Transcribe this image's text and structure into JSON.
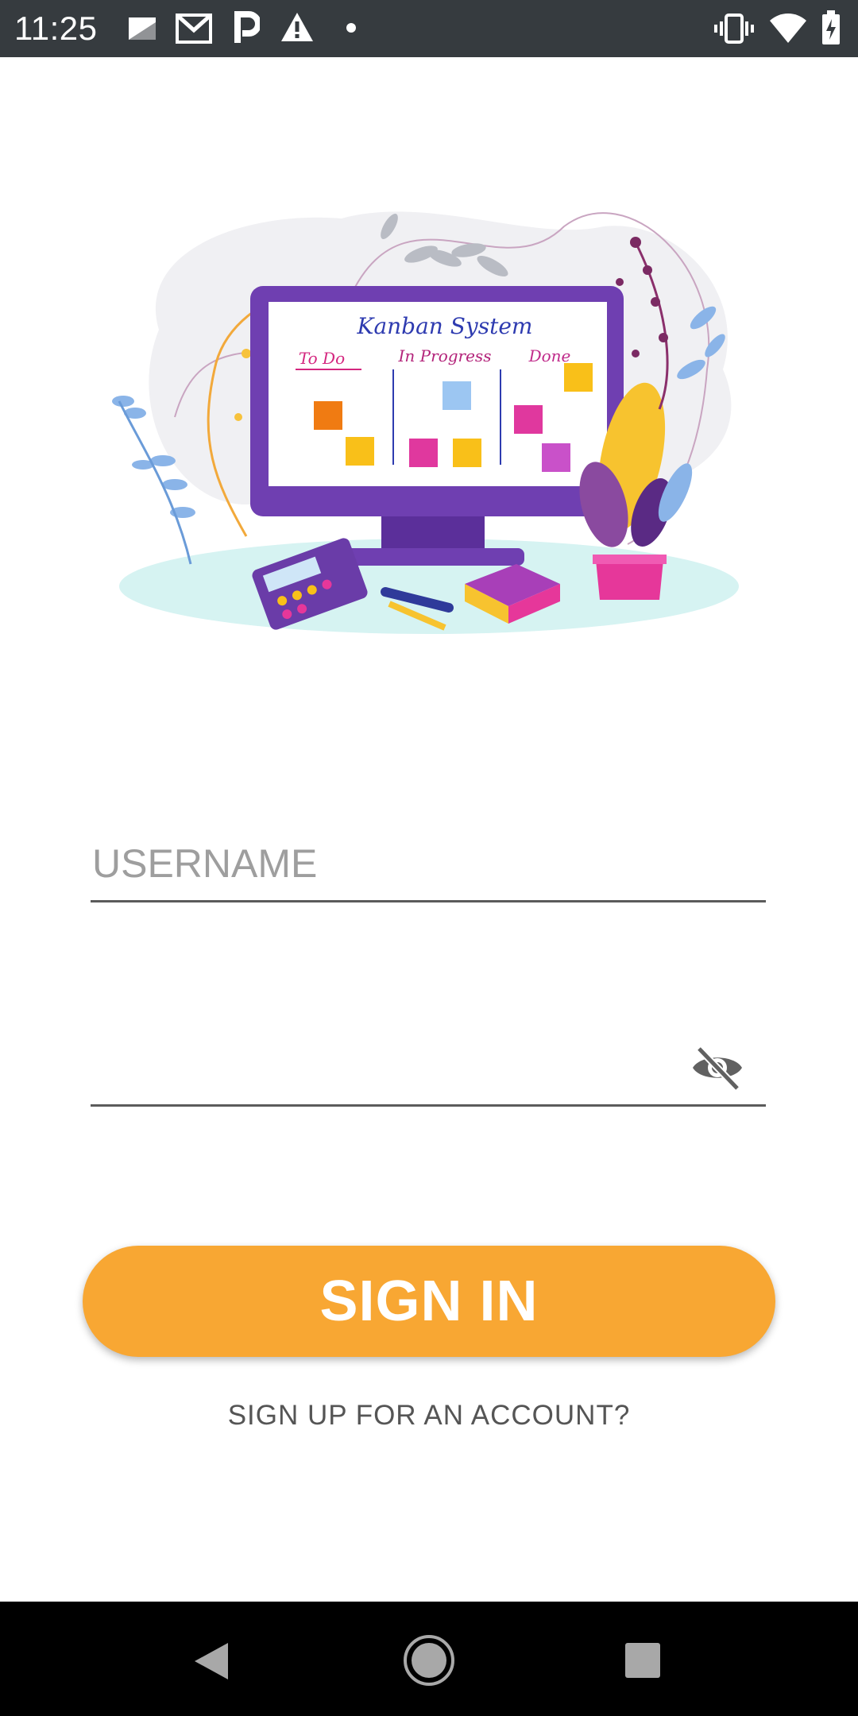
{
  "status_bar": {
    "time": "11:25",
    "left_icons": [
      "notification-icon",
      "gmail-icon",
      "parking-icon",
      "warning-icon",
      "dot-icon"
    ],
    "right_icons": [
      "vibrate-icon",
      "wifi-icon",
      "battery-icon"
    ]
  },
  "illustration": {
    "title": "Kanban System",
    "columns": [
      "To Do",
      "In Progress",
      "Done"
    ]
  },
  "form": {
    "username_placeholder": "USERNAME",
    "username_value": "",
    "password_value": "",
    "password_toggle_icon": "visibility-off-icon"
  },
  "actions": {
    "sign_in_label": "SIGN IN",
    "sign_up_label": "SIGN UP FOR AN ACCOUNT?"
  },
  "colors": {
    "status_bar": "#363b3f",
    "primary_button": "#f8a733",
    "nav_bar": "#000000"
  },
  "nav_bar": {
    "buttons": [
      "back-icon",
      "home-icon",
      "recents-icon"
    ]
  }
}
